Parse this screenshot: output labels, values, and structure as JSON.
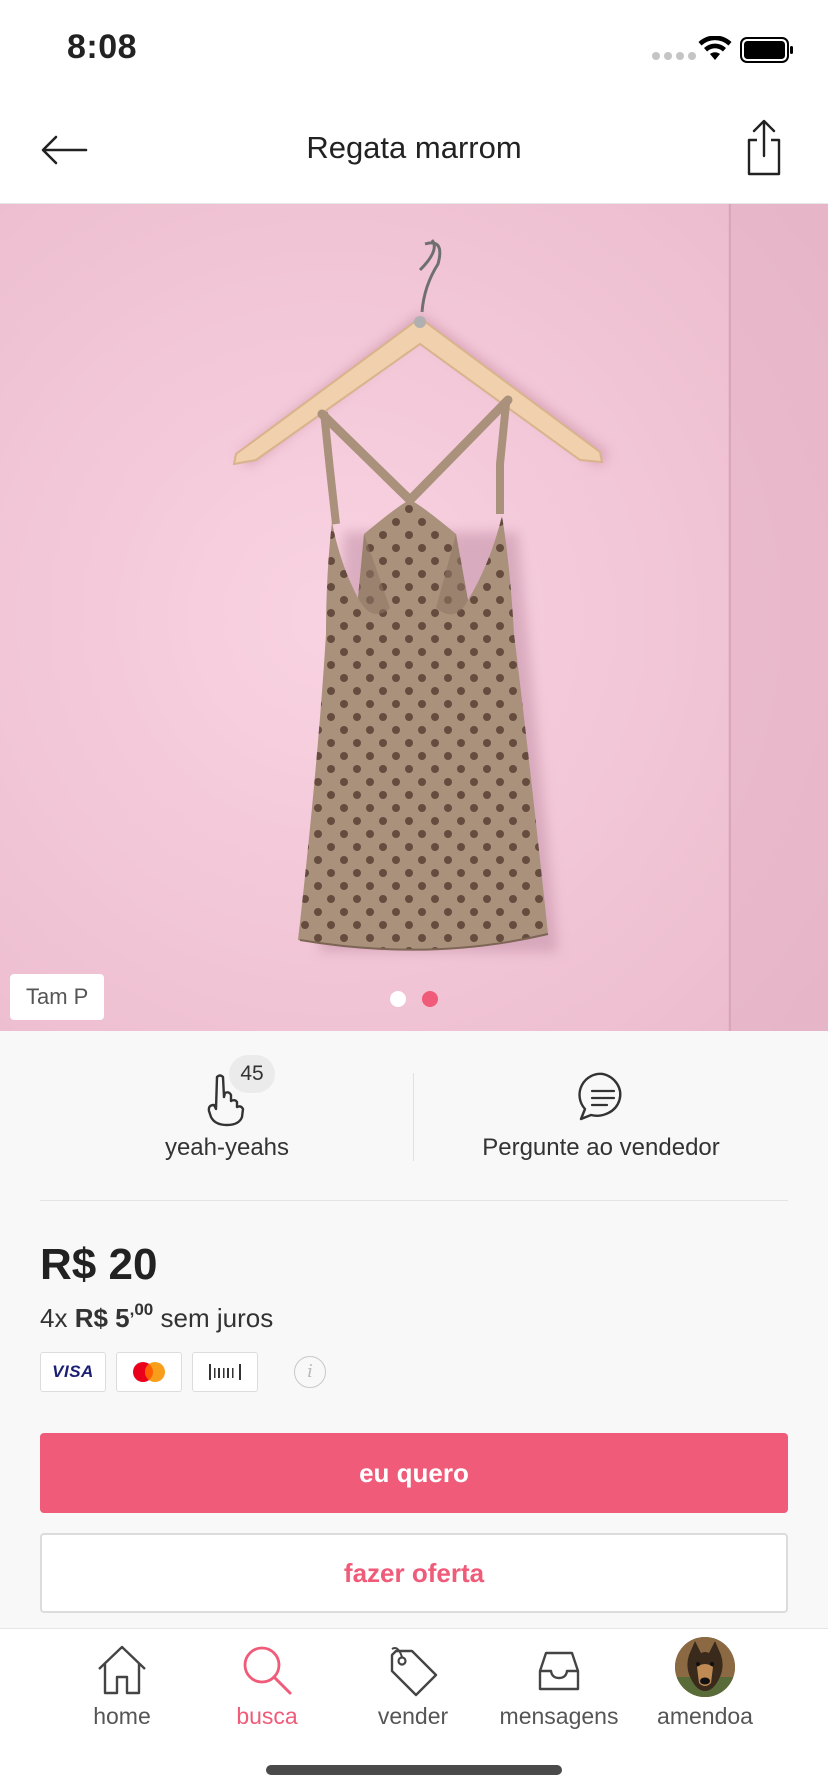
{
  "status_bar": {
    "time": "8:08"
  },
  "nav": {
    "title": "Regata marrom"
  },
  "product": {
    "size_tag": "Tam P",
    "image_count": 2,
    "active_image": 2
  },
  "actions": {
    "yeah_count": "45",
    "yeah_label": "yeah-yeahs",
    "ask_label": "Pergunte ao vendedor"
  },
  "pricing": {
    "price": "R$ 20",
    "installments_prefix": "4x",
    "installment_value": "R$ 5",
    "installment_cents": ",00",
    "installments_suffix": "sem juros"
  },
  "payments": {
    "visa_label": "VISA",
    "info_label": "i"
  },
  "buttons": {
    "buy": "eu quero",
    "offer": "fazer oferta"
  },
  "tabs": [
    {
      "label": "home",
      "icon": "home-icon",
      "active": false
    },
    {
      "label": "busca",
      "icon": "search-icon",
      "active": true
    },
    {
      "label": "vender",
      "icon": "tag-icon",
      "active": false
    },
    {
      "label": "mensagens",
      "icon": "inbox-icon",
      "active": false
    },
    {
      "label": "amendoa",
      "icon": "avatar",
      "active": false
    }
  ],
  "colors": {
    "accent": "#ef5b78",
    "background": "#f8f8f8",
    "image_bg": "#f3c6d6",
    "garment": "#a9917c",
    "dots": "#5d4437"
  }
}
